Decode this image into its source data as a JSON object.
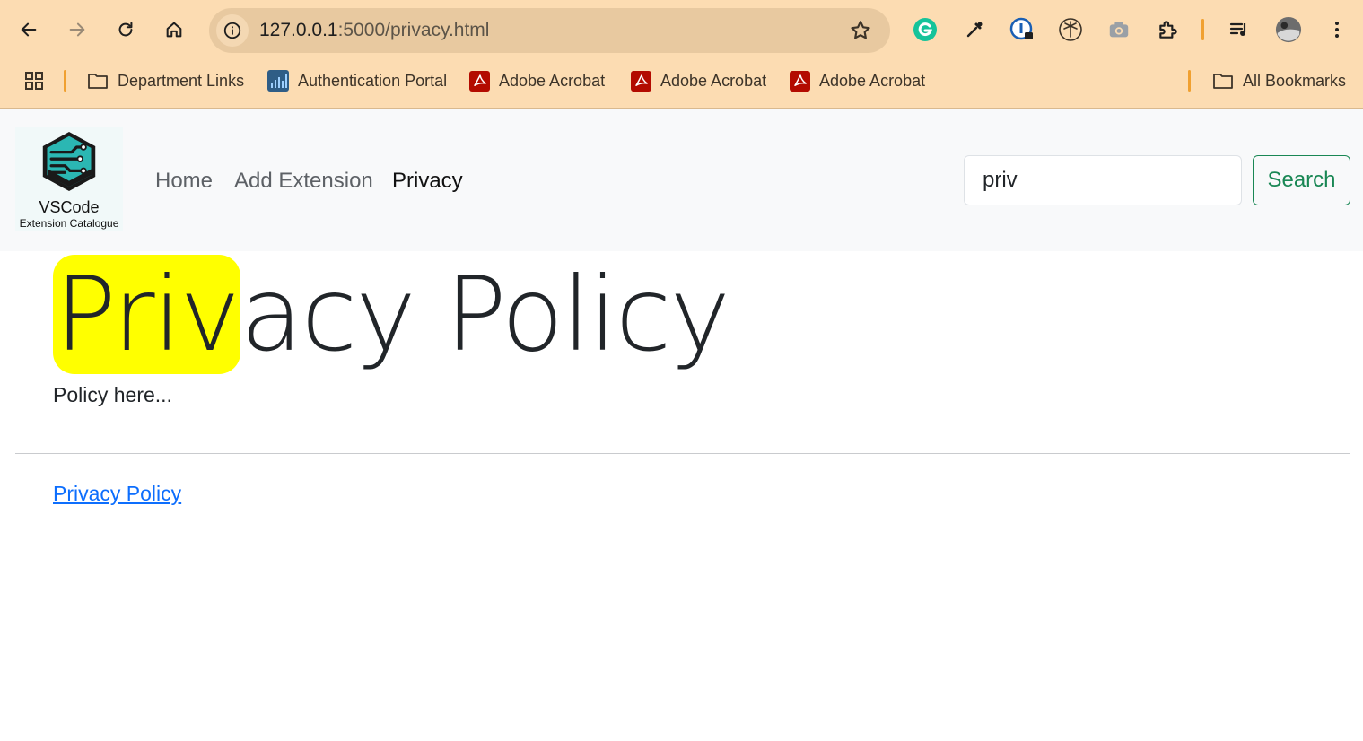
{
  "browser": {
    "url_host": "127.0.0.1",
    "url_path": ":5000/privacy.html",
    "bookmarks": [
      {
        "label": "Department Links",
        "icon": "folder-icon"
      },
      {
        "label": "Authentication Portal",
        "icon": "portal-icon"
      },
      {
        "label": "Adobe Acrobat",
        "icon": "acrobat-icon"
      },
      {
        "label": "Adobe Acrobat",
        "icon": "acrobat-icon"
      },
      {
        "label": "Adobe Acrobat",
        "icon": "acrobat-icon"
      }
    ],
    "all_bookmarks": "All Bookmarks"
  },
  "site": {
    "logo_title": "VSCode",
    "logo_subtitle": "Extension Catalogue",
    "nav": [
      "Home",
      "Add Extension",
      "Privacy"
    ],
    "search_value": "priv",
    "search_button": "Search"
  },
  "content": {
    "heading_highlight": "Priv",
    "heading_rest": "acy Policy",
    "body": "Policy here...",
    "footer_link": "Privacy Policy"
  },
  "colors": {
    "chrome_bg": "#fcdcb2",
    "highlight": "#ffff00",
    "search_button": "#198754",
    "link": "#0d6efd"
  }
}
